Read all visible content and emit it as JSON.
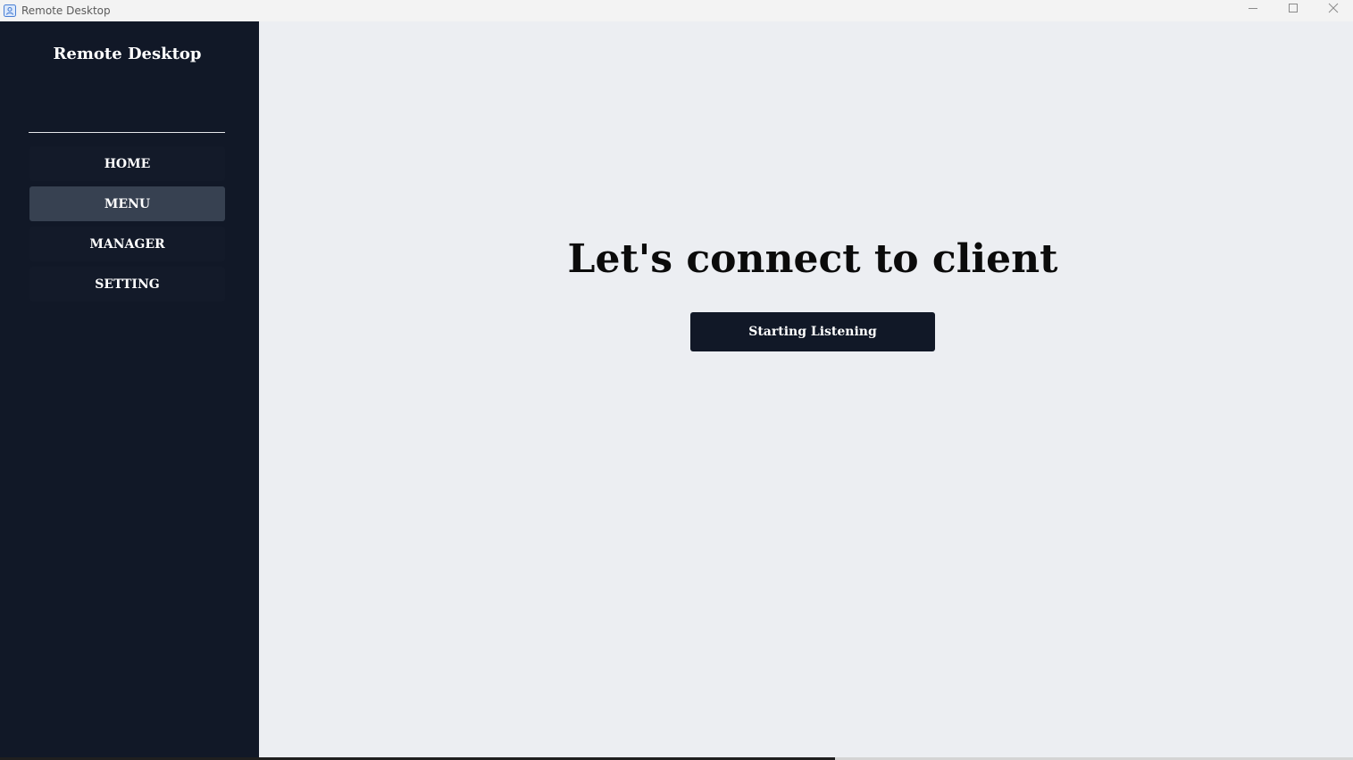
{
  "window": {
    "title": "Remote Desktop",
    "icon": "remote-desktop-app-icon",
    "controls": [
      "minimize-icon",
      "maximize-icon",
      "close-icon"
    ]
  },
  "sidebar": {
    "title": "Remote Desktop",
    "items": [
      {
        "label": "HOME",
        "active": false
      },
      {
        "label": "MENU",
        "active": true
      },
      {
        "label": "MANAGER",
        "active": false
      },
      {
        "label": "SETTING",
        "active": false
      }
    ]
  },
  "main": {
    "heading": "Let's connect to client",
    "button_label": "Starting Listening"
  },
  "progress": {
    "fraction": 0.617
  },
  "colors": {
    "sidebar_bg": "#111827",
    "active_item_bg": "#374151",
    "main_bg": "#eceef2",
    "button_bg": "#111827"
  }
}
